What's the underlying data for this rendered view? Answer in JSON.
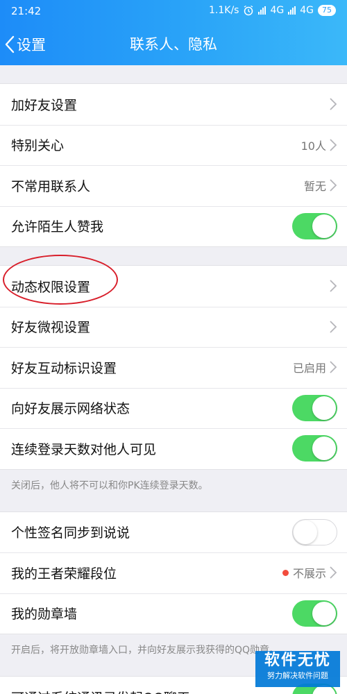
{
  "status_bar": {
    "time": "21:42",
    "speed": "1.1K/s",
    "net1": "4G",
    "net2": "4G",
    "battery": "75"
  },
  "nav": {
    "back_label": "设置",
    "title": "联系人、隐私"
  },
  "section1": [
    {
      "label": "加好友设置",
      "value": "",
      "control": "chevron"
    },
    {
      "label": "特别关心",
      "value": "10人",
      "control": "chevron"
    },
    {
      "label": "不常用联系人",
      "value": "暂无",
      "control": "chevron"
    },
    {
      "label": "允许陌生人赞我",
      "control": "toggle",
      "on": true
    }
  ],
  "section2": [
    {
      "label": "动态权限设置",
      "value": "",
      "control": "chevron"
    },
    {
      "label": "好友微视设置",
      "value": "",
      "control": "chevron"
    },
    {
      "label": "好友互动标识设置",
      "value": "已启用",
      "control": "chevron"
    },
    {
      "label": "向好友展示网络状态",
      "control": "toggle",
      "on": true
    },
    {
      "label": "连续登录天数对他人可见",
      "control": "toggle",
      "on": true
    }
  ],
  "section2_note": "关闭后，他人将不可以和你PK连续登录天数。",
  "section3": [
    {
      "label": "个性签名同步到说说",
      "control": "toggle",
      "on": false
    },
    {
      "label": "我的王者荣耀段位",
      "value": "不展示",
      "control": "chevron",
      "dot": true
    },
    {
      "label": "我的勋章墙",
      "control": "toggle",
      "on": true
    }
  ],
  "section3_note": "开启后，将开放勋章墙入口，并向好友展示我获得的QQ勋章。",
  "section4": [
    {
      "label": "可通过系统通讯录发起QQ聊天",
      "control": "toggle",
      "on": true
    }
  ],
  "watermark": {
    "title": "软件无忧",
    "subtitle": "努力解决软件问题"
  },
  "colors": {
    "header_start": "#1d8cf8",
    "header_end": "#3bb8f9",
    "toggle_on": "#4cd964",
    "annotation_circle": "#d81e2a",
    "badge_dot": "#f24c3d"
  }
}
